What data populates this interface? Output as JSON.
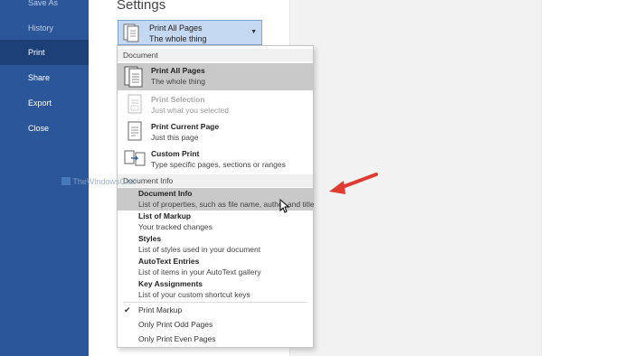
{
  "sidebar": {
    "items": [
      {
        "label": "Save As",
        "state": "dim"
      },
      {
        "label": "History",
        "state": "dim"
      },
      {
        "label": "Print",
        "state": "active"
      },
      {
        "label": "Share",
        "state": "normal"
      },
      {
        "label": "Export",
        "state": "normal"
      },
      {
        "label": "Close",
        "state": "normal"
      }
    ]
  },
  "settings": {
    "title": "Settings",
    "combo": {
      "line1": "Print All Pages",
      "line2": "The whole thing",
      "icon": "document-pages-icon",
      "caret": "▼"
    }
  },
  "dropdown": {
    "document_header": "Document",
    "document_items": [
      {
        "title": "Print All Pages",
        "desc": "The whole thing",
        "icon": "document-pages-icon",
        "state": "selected"
      },
      {
        "title": "Print Selection",
        "desc": "Just what you selected",
        "icon": "selection-page-icon",
        "state": "disabled"
      },
      {
        "title": "Print Current Page",
        "desc": "Just this page",
        "icon": "single-page-icon",
        "state": "normal"
      },
      {
        "title": "Custom Print",
        "desc": "Type specific pages, sections or ranges",
        "icon": "custom-print-icon",
        "state": "normal"
      }
    ],
    "info_header": "Document Info",
    "info_items": [
      {
        "title": "Document Info",
        "desc": "List of properties, such as file name, author and title",
        "state": "highlighted"
      },
      {
        "title": "List of Markup",
        "desc": "Your tracked changes",
        "state": "normal"
      },
      {
        "title": "Styles",
        "desc": "List of styles used in your document",
        "state": "normal"
      },
      {
        "title": "AutoText Entries",
        "desc": "List of items in your AutoText gallery",
        "state": "normal"
      },
      {
        "title": "Key Assignments",
        "desc": "List of your custom shortcut keys",
        "state": "normal"
      }
    ],
    "options": [
      {
        "label": "Print Markup",
        "checked": true,
        "check_glyph": "✔"
      },
      {
        "label": "Only Print Odd Pages",
        "checked": false,
        "check_glyph": ""
      },
      {
        "label": "Only Print Even Pages",
        "checked": false,
        "check_glyph": ""
      }
    ]
  },
  "watermark": {
    "text": "TheWindowsClub"
  },
  "colors": {
    "sidebar": "#2b579a",
    "sidebar_active": "#1d4079",
    "combo_bg": "#c5d8f1",
    "highlight": "#c9c9c9",
    "annotation_arrow": "#e03a33"
  }
}
